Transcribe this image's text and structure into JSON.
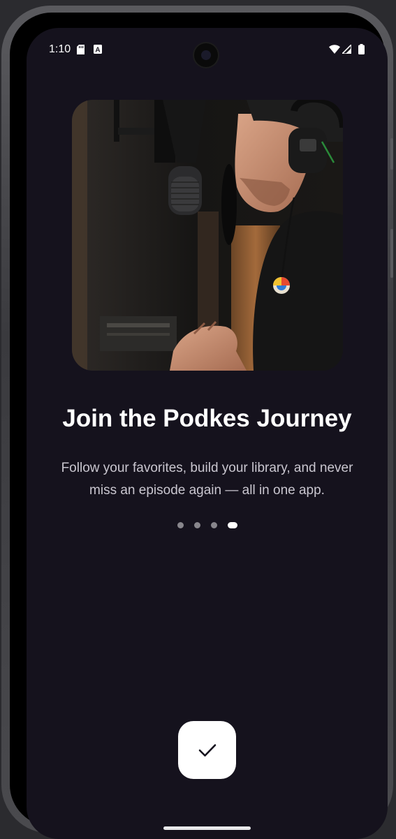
{
  "status_bar": {
    "time": "1:10"
  },
  "onboarding": {
    "title": "Join the Podkes Journey",
    "subtitle": "Follow your favorites, build your library, and never miss an episode again — all in one app.",
    "page_count": 4,
    "active_page": 4
  },
  "icons": {
    "done": "check-icon",
    "sd_card": "sd-card-icon",
    "keyboard": "a-icon",
    "wifi": "wifi-icon",
    "signal": "signal-icon",
    "battery": "battery-icon"
  },
  "colors": {
    "background": "#15121d",
    "title": "#ffffff",
    "subtitle": "#c9c6cf",
    "dot_inactive": "#88868c",
    "dot_active": "#ffffff",
    "button_bg": "#ffffff"
  }
}
